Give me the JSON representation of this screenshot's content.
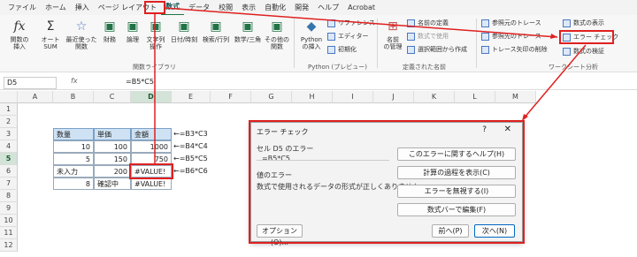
{
  "menu": [
    "ファイル",
    "ホーム",
    "挿入",
    "ページ レイアウト",
    "数式",
    "データ",
    "校閲",
    "表示",
    "自動化",
    "開発",
    "ヘルプ",
    "Acrobat"
  ],
  "ribbon": {
    "fx_label": "関数の\n挿入",
    "autosum": "オート\nSUM",
    "recent": "最近使った\n関数",
    "finance": "財務",
    "logic": "論理",
    "text": "文字列\n操作",
    "datetime": "日付/時刻",
    "lookup": "検索/行列",
    "math": "数学/三角",
    "other": "その他の\n関数",
    "group_library": "関数ライブラリ",
    "python": "Python\nの挿入",
    "py_ref": "リファレンス",
    "py_editor": "エディター",
    "py_init": "初期化",
    "group_python": "Python (プレビュー)",
    "name_mgr": "名前\nの管理",
    "define_name": "名前の定義",
    "use_in_formula": "数式で使用",
    "create_from_sel": "選択範囲から作成",
    "group_names": "定義された名前",
    "trace_precedents": "参照元のトレース",
    "trace_dependents": "参照先のトレース",
    "remove_arrows": "トレース矢印の削除",
    "show_formulas": "数式の表示",
    "error_check": "エラー チェック",
    "eval_formula": "数式の検証",
    "group_audit": "ワークシート分析"
  },
  "formula_bar": {
    "namebox": "D5",
    "fx": "fx",
    "formula": "=B5*C5"
  },
  "columns": [
    "A",
    "B",
    "C",
    "D",
    "E",
    "F",
    "G",
    "H",
    "I",
    "J",
    "K",
    "L",
    "M"
  ],
  "rows": [
    "1",
    "2",
    "3",
    "4",
    "5",
    "6",
    "7",
    "8",
    "9",
    "10",
    "11",
    "12"
  ],
  "table": {
    "h_qty": "数量",
    "h_price": "単価",
    "h_amount": "金額",
    "r3": [
      "10",
      "100",
      "1000"
    ],
    "r4": [
      "5",
      "150",
      "750"
    ],
    "r5": [
      "未入力",
      "200",
      "#VALUE!"
    ],
    "r6": [
      "8",
      "確認中",
      "#VALUE!"
    ]
  },
  "notes": [
    "←=B3*C3",
    "←=B4*C4",
    "←=B5*C5",
    "←=B6*C6"
  ],
  "dialog": {
    "title": "エラー チェック",
    "q": "?",
    "close": "✕",
    "cell_err": "セル D5 のエラー",
    "formula": "=B5*C5",
    "err_type": "値のエラー",
    "err_desc": "数式で使用されるデータの形式が正しくありません。",
    "btn_help": "このエラーに関するヘルプ(H)",
    "btn_calc": "計算の過程を表示(C)",
    "btn_ignore": "エラーを無視する(I)",
    "btn_edit": "数式バーで編集(F)",
    "btn_options": "オプション(O)...",
    "btn_prev": "前へ(P)",
    "btn_next": "次へ(N)"
  },
  "colors": {
    "accent": "#217346",
    "highlight": "#e02020",
    "header_fill": "#cfe2f3"
  }
}
